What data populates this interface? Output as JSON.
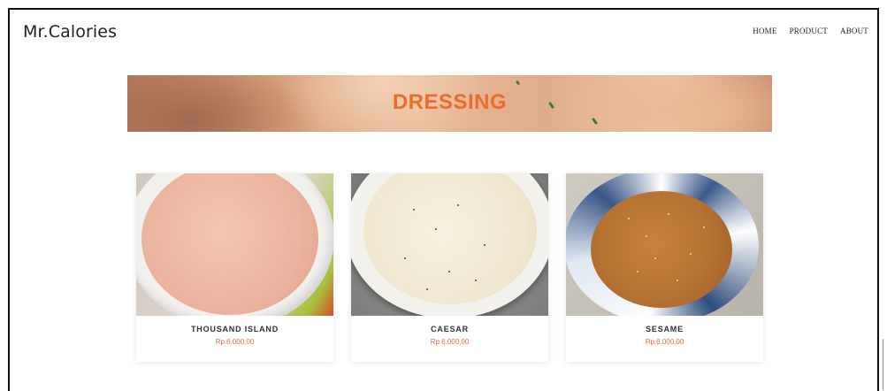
{
  "header": {
    "brand": "Mr.Calories",
    "nav": [
      {
        "label": "HOME"
      },
      {
        "label": "PRODUCT"
      },
      {
        "label": "ABOUT"
      }
    ]
  },
  "banner": {
    "title": "DRESSING"
  },
  "products": [
    {
      "name": "THOUSAND ISLAND",
      "price": "Rp.6.000,00"
    },
    {
      "name": "CAESAR",
      "price": "Rp.6.000,00"
    },
    {
      "name": "SESAME",
      "price": "Rp.6.000,00"
    }
  ],
  "colors": {
    "accent": "#f06a2e",
    "price": "#e8663a"
  }
}
